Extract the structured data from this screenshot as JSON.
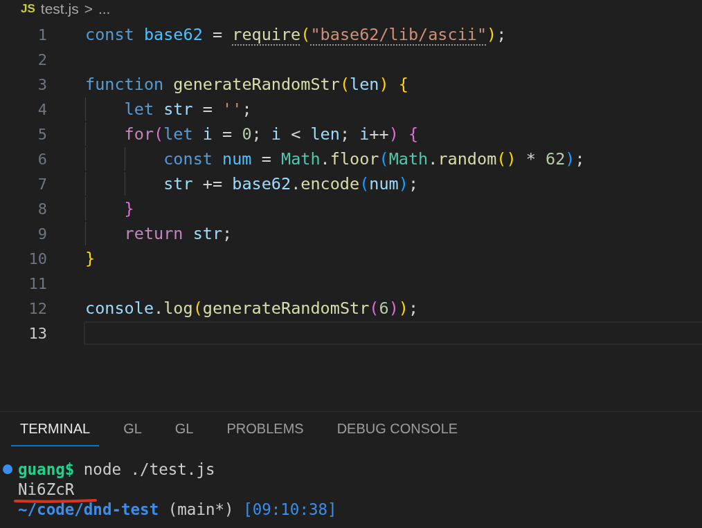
{
  "breadcrumb": {
    "file_badge": "JS",
    "file": "test.js",
    "separator": ">",
    "more": "..."
  },
  "editor": {
    "lines": [
      {
        "number": "1",
        "current": false,
        "tokens": [
          {
            "kind": "keyword",
            "text": "const "
          },
          {
            "kind": "constant",
            "text": "base62"
          },
          {
            "kind": "plain",
            "text": " = "
          },
          {
            "kind": "function",
            "text": "require",
            "hint": true
          },
          {
            "kind": "bracket",
            "text": "("
          },
          {
            "kind": "string",
            "text": "\"base62/lib/ascii\"",
            "hint": true
          },
          {
            "kind": "bracket",
            "text": ")"
          },
          {
            "kind": "plain",
            "text": ";"
          }
        ]
      },
      {
        "number": "2",
        "current": false
      },
      {
        "number": "3",
        "current": false,
        "tokens": [
          {
            "kind": "keyword",
            "text": "function "
          },
          {
            "kind": "function",
            "text": "generateRandomStr"
          },
          {
            "kind": "bracket",
            "text": "("
          },
          {
            "kind": "variable",
            "text": "len"
          },
          {
            "kind": "bracket",
            "text": ") {"
          }
        ]
      },
      {
        "number": "4",
        "current": false,
        "tokens": [
          {
            "kind": "keyword",
            "text": "    let "
          },
          {
            "kind": "variable",
            "text": "str"
          },
          {
            "kind": "plain",
            "text": " = "
          },
          {
            "kind": "string",
            "text": "''"
          },
          {
            "kind": "plain",
            "text": ";"
          }
        ]
      },
      {
        "number": "5",
        "current": false,
        "tokens": [
          {
            "kind": "control",
            "text": "    for"
          },
          {
            "kind": "bracket2",
            "text": "("
          },
          {
            "kind": "keyword",
            "text": "let "
          },
          {
            "kind": "variable",
            "text": "i"
          },
          {
            "kind": "plain",
            "text": " = "
          },
          {
            "kind": "number",
            "text": "0"
          },
          {
            "kind": "plain",
            "text": "; "
          },
          {
            "kind": "variable",
            "text": "i"
          },
          {
            "kind": "plain",
            "text": " < "
          },
          {
            "kind": "variable",
            "text": "len"
          },
          {
            "kind": "plain",
            "text": "; "
          },
          {
            "kind": "variable",
            "text": "i"
          },
          {
            "kind": "plain",
            "text": "++"
          },
          {
            "kind": "bracket2",
            "text": ") {"
          }
        ]
      },
      {
        "number": "6",
        "current": false,
        "tokens": [
          {
            "kind": "keyword",
            "text": "        const "
          },
          {
            "kind": "constant",
            "text": "num"
          },
          {
            "kind": "plain",
            "text": " = "
          },
          {
            "kind": "class",
            "text": "Math"
          },
          {
            "kind": "plain",
            "text": "."
          },
          {
            "kind": "function",
            "text": "floor"
          },
          {
            "kind": "bracket3",
            "text": "("
          },
          {
            "kind": "class",
            "text": "Math"
          },
          {
            "kind": "plain",
            "text": "."
          },
          {
            "kind": "function",
            "text": "random"
          },
          {
            "kind": "bracket",
            "text": "()"
          },
          {
            "kind": "plain",
            "text": " * "
          },
          {
            "kind": "number",
            "text": "62"
          },
          {
            "kind": "bracket3",
            "text": ")"
          },
          {
            "kind": "plain",
            "text": ";"
          }
        ]
      },
      {
        "number": "7",
        "current": false,
        "tokens": [
          {
            "kind": "variable",
            "text": "        str"
          },
          {
            "kind": "plain",
            "text": " += "
          },
          {
            "kind": "variable",
            "text": "base62"
          },
          {
            "kind": "plain",
            "text": "."
          },
          {
            "kind": "function",
            "text": "encode"
          },
          {
            "kind": "bracket3",
            "text": "("
          },
          {
            "kind": "variable",
            "text": "num"
          },
          {
            "kind": "bracket3",
            "text": ")"
          },
          {
            "kind": "plain",
            "text": ";"
          }
        ]
      },
      {
        "number": "8",
        "current": false,
        "tokens": [
          {
            "kind": "bracket2",
            "text": "    }"
          }
        ]
      },
      {
        "number": "9",
        "current": false,
        "tokens": [
          {
            "kind": "control",
            "text": "    return "
          },
          {
            "kind": "variable",
            "text": "str"
          },
          {
            "kind": "plain",
            "text": ";"
          }
        ]
      },
      {
        "number": "10",
        "current": false,
        "tokens": [
          {
            "kind": "bracket",
            "text": "}"
          }
        ]
      },
      {
        "number": "11",
        "current": false
      },
      {
        "number": "12",
        "current": false,
        "tokens": [
          {
            "kind": "variable",
            "text": "console"
          },
          {
            "kind": "plain",
            "text": "."
          },
          {
            "kind": "function",
            "text": "log"
          },
          {
            "kind": "bracket",
            "text": "("
          },
          {
            "kind": "function",
            "text": "generateRandomStr"
          },
          {
            "kind": "bracket2",
            "text": "("
          },
          {
            "kind": "number",
            "text": "6"
          },
          {
            "kind": "bracket2",
            "text": ")"
          },
          {
            "kind": "bracket",
            "text": ")"
          },
          {
            "kind": "plain",
            "text": ";"
          }
        ]
      },
      {
        "number": "13",
        "current": true
      }
    ]
  },
  "panel": {
    "tabs": [
      {
        "label": "TERMINAL",
        "selected": true
      },
      {
        "label": "GL",
        "selected": false
      },
      {
        "label": "GL",
        "selected": false
      },
      {
        "label": "PROBLEMS",
        "selected": false
      },
      {
        "label": "DEBUG CONSOLE",
        "selected": false
      }
    ],
    "terminal": [
      {
        "kind": "prompt",
        "user": "guang$",
        "command": "node ./test.js"
      },
      {
        "kind": "output",
        "text": "Ni6ZcR",
        "marked": true
      },
      {
        "kind": "path",
        "path": "~/code/dnd-test",
        "branch": "(main*)",
        "time": "[09:10:38]"
      }
    ]
  }
}
